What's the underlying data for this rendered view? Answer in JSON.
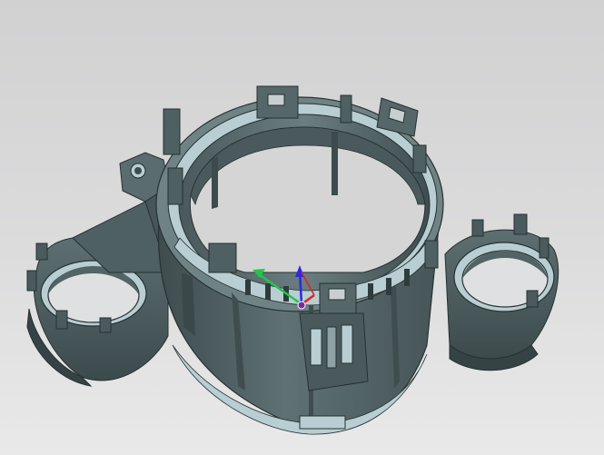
{
  "viewport": {
    "background_top": "#d1d1d2",
    "background_bottom": "#e9e9ea"
  },
  "model": {
    "icon": "cad-part-model",
    "body_color": "#556567",
    "body_dark": "#3d4b4d",
    "body_light": "#6f8385",
    "edge_color": "#263132",
    "face_highlight": "#b9ced2"
  },
  "triad": {
    "icon": "coordinate-axes-triad",
    "x_color": "#22c74a",
    "y_color": "#e02222",
    "z_color": "#2a2ae0",
    "origin_color": "#7a2aa0"
  }
}
